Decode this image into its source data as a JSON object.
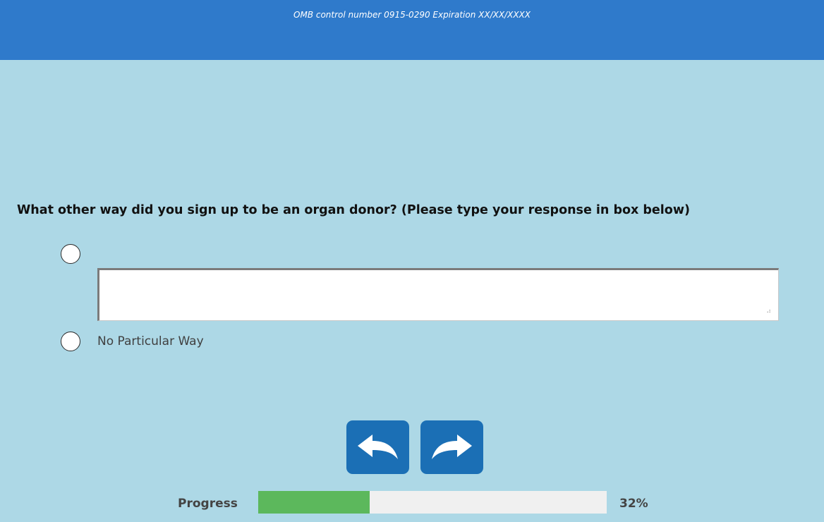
{
  "header": {
    "omb_text": "OMB control number 0915-0290 Expiration XX/XX/XXXX",
    "color": "#2F7ACB"
  },
  "question": {
    "text": "What other way did you sign up to be an organ donor? (Please type your response in box below)"
  },
  "options": [
    {
      "icon": "radio-unselected",
      "has_text_input": true,
      "value": ""
    },
    {
      "icon": "radio-unselected",
      "label": "No Particular Way"
    }
  ],
  "navigation": {
    "back_icon": "arrow-back-icon",
    "next_icon": "arrow-forward-icon",
    "button_color": "#1B6FB5"
  },
  "progress": {
    "label": "Progress",
    "percent_text": "32%",
    "fraction": 0.32,
    "fill_color": "#5CB85C",
    "track_color": "#F0F0F0"
  },
  "background_color": "#ADD8E6"
}
